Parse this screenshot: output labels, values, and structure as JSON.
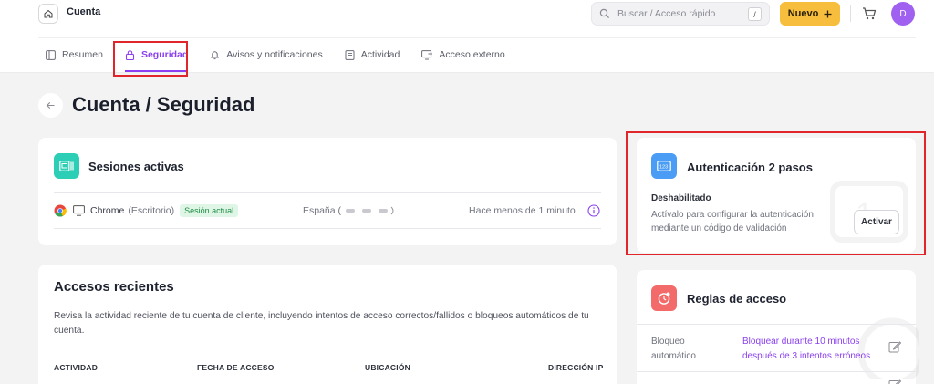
{
  "header": {
    "app_title": "Cuenta",
    "search": {
      "placeholder": "Buscar / Acceso rápido",
      "shortcut": "/"
    },
    "new_button_label": "Nuevo",
    "avatar_initial": "D"
  },
  "tabs": [
    {
      "label": "Resumen",
      "icon": "layout-icon"
    },
    {
      "label": "Seguridad",
      "icon": "lock-icon",
      "active": true
    },
    {
      "label": "Avisos y notificaciones",
      "icon": "bell-icon"
    },
    {
      "label": "Actividad",
      "icon": "list-icon"
    },
    {
      "label": "Acceso externo",
      "icon": "monitor-icon"
    }
  ],
  "page": {
    "title": "Cuenta / Seguridad"
  },
  "sessions": {
    "title": "Sesiones activas",
    "row": {
      "browser": "Chrome",
      "device": "(Escritorio)",
      "badge": "Sesión actual",
      "location": "España (",
      "time": "Hace menos de 1 minuto"
    }
  },
  "recent": {
    "title": "Accesos recientes",
    "description": "Revisa la actividad reciente de tu cuenta de cliente, incluyendo intentos de acceso correctos/fallidos o bloqueos automáticos de tu cuenta.",
    "columns": [
      "ACTIVIDAD",
      "FECHA DE ACCESO",
      "UBICACIÓN",
      "DIRECCIÓN IP"
    ]
  },
  "two_factor": {
    "title": "Autenticación 2 pasos",
    "status": "Deshabilitado",
    "description": "Actívalo para configurar la autenticación mediante un código de validación",
    "button_label": "Activar"
  },
  "rules": {
    "title": "Reglas de acceso",
    "items": [
      {
        "key": "Bloqueo automático",
        "value": "Bloquear durante 10 minutos después de 3 intentos erróneos"
      }
    ]
  },
  "colors": {
    "accent": "#8a3ff0",
    "new_button": "#f7be3d",
    "sessions_icon": "#2ccfb5",
    "two_factor_icon": "#4a9cf5",
    "rules_icon": "#f26a6a",
    "highlight": "#e0262a"
  }
}
